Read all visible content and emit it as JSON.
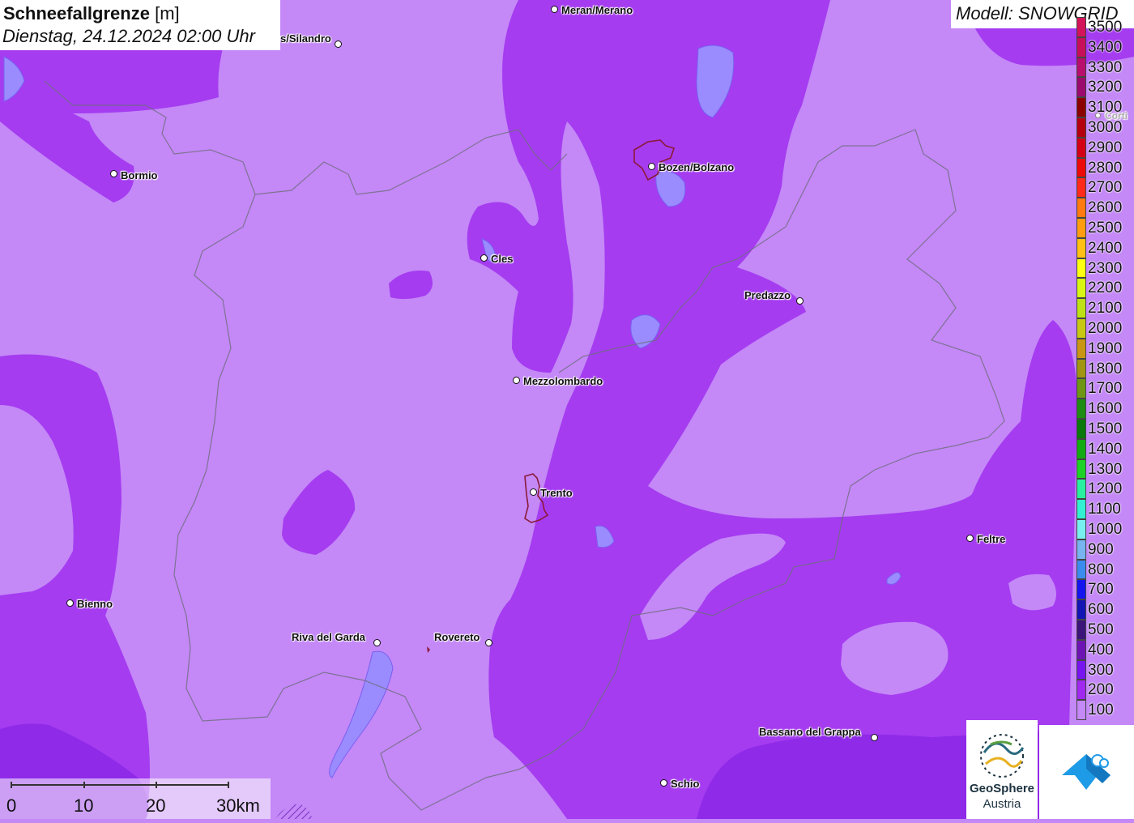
{
  "map": {
    "title": "Schneefallgrenze",
    "title_unit": "[m]",
    "datetime": "Dienstag, 24.12.2024 02:00 Uhr",
    "model": "Modell: SNOWGRID"
  },
  "colors": {
    "band_100": "#c488f7",
    "band_200": "#a53cf0",
    "band_300": "#8a2be2",
    "water": "#9a8cff"
  },
  "cities": [
    {
      "name": "Meran/Merano"
    },
    {
      "name": "s/Silandro"
    },
    {
      "name": "Bormio"
    },
    {
      "name": "Bozen/Bolzano"
    },
    {
      "name": "Cles"
    },
    {
      "name": "Predazzo"
    },
    {
      "name": "Mezzolombardo"
    },
    {
      "name": "Trento"
    },
    {
      "name": "Feltre"
    },
    {
      "name": "Bienno"
    },
    {
      "name": "Riva del Garda"
    },
    {
      "name": "Rovereto"
    },
    {
      "name": "Bassano del Grappa"
    },
    {
      "name": "Schio"
    },
    {
      "name": "Corti"
    }
  ],
  "legend": {
    "items": [
      {
        "label": "3500",
        "color": "#d4145a"
      },
      {
        "label": "3400",
        "color": "#c8105a"
      },
      {
        "label": "3300",
        "color": "#b80f6e"
      },
      {
        "label": "3200",
        "color": "#9c0a6e"
      },
      {
        "label": "3100",
        "color": "#8b0000"
      },
      {
        "label": "3000",
        "color": "#b50010"
      },
      {
        "label": "2900",
        "color": "#d40015"
      },
      {
        "label": "2800",
        "color": "#ec0a0a"
      },
      {
        "label": "2700",
        "color": "#ff2a1a"
      },
      {
        "label": "2600",
        "color": "#ff7a10"
      },
      {
        "label": "2500",
        "color": "#ff9c10"
      },
      {
        "label": "2400",
        "color": "#ffbf14"
      },
      {
        "label": "2300",
        "color": "#ffff14"
      },
      {
        "label": "2200",
        "color": "#d9f514"
      },
      {
        "label": "2100",
        "color": "#bfe014"
      },
      {
        "label": "2000",
        "color": "#c8c814"
      },
      {
        "label": "1900",
        "color": "#c89614"
      },
      {
        "label": "1800",
        "color": "#a09614"
      },
      {
        "label": "1700",
        "color": "#6e9614"
      },
      {
        "label": "1600",
        "color": "#1e8c14"
      },
      {
        "label": "1500",
        "color": "#0a780a"
      },
      {
        "label": "1400",
        "color": "#14aa14"
      },
      {
        "label": "1300",
        "color": "#1ed228"
      },
      {
        "label": "1200",
        "color": "#28f0a0"
      },
      {
        "label": "1100",
        "color": "#32f0d2"
      },
      {
        "label": "1000",
        "color": "#78f0f0"
      },
      {
        "label": "900",
        "color": "#78b4f0"
      },
      {
        "label": "800",
        "color": "#3c8cf0"
      },
      {
        "label": "700",
        "color": "#1414f0"
      },
      {
        "label": "600",
        "color": "#1414b4"
      },
      {
        "label": "500",
        "color": "#3c147a"
      },
      {
        "label": "400",
        "color": "#6e14b4"
      },
      {
        "label": "300",
        "color": "#7814f0"
      },
      {
        "label": "200",
        "color": "#a028f0"
      },
      {
        "label": "100",
        "color": "#c488f7"
      }
    ]
  },
  "scale": {
    "labels": [
      "0",
      "10",
      "20",
      "30km"
    ]
  },
  "logos": {
    "geosphere_line1": "GeoSphere",
    "geosphere_line2": "Austria"
  }
}
